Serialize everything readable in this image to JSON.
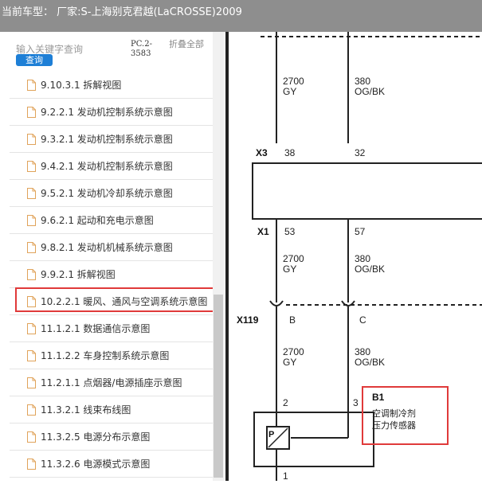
{
  "header": {
    "title": "当前车型：  厂家:S-上海别克君越(LaCROSSE)2009"
  },
  "search": {
    "placeholder": "输入关键字查询",
    "button_label": "查询"
  },
  "code_label": "PC.2-3583",
  "collapse_label": "折叠全部",
  "doc_list": {
    "items": [
      {
        "label": "9.10.3.1 拆解视图"
      },
      {
        "label": "9.2.2.1 发动机控制系统示意图"
      },
      {
        "label": "9.3.2.1 发动机控制系统示意图"
      },
      {
        "label": "9.4.2.1 发动机控制系统示意图"
      },
      {
        "label": "9.5.2.1 发动机冷却系统示意图"
      },
      {
        "label": "9.6.2.1 起动和充电示意图"
      },
      {
        "label": "9.8.2.1 发动机机械系统示意图"
      },
      {
        "label": "9.9.2.1 拆解视图"
      },
      {
        "label": "10.2.2.1 暖风、通风与空调系统示意图",
        "selected": true
      },
      {
        "label": "11.1.2.1 数据通信示意图"
      },
      {
        "label": "11.1.2.2 车身控制系统示意图"
      },
      {
        "label": "11.2.1.1 点烟器/电源插座示意图"
      },
      {
        "label": "11.3.2.1 线束布线图"
      },
      {
        "label": "11.3.2.5 电源分布示意图"
      },
      {
        "label": "11.3.2.6 电源模式示意图"
      }
    ]
  },
  "diagram": {
    "connectors": {
      "x3": "X3",
      "x1": "X1",
      "x119": "X119"
    },
    "wire_top_left": {
      "num": "2700",
      "color": "GY"
    },
    "wire_top_right": {
      "num": "380",
      "color": "OG/BK"
    },
    "x3_pins": {
      "left": "38",
      "right": "32"
    },
    "x1_pins": {
      "left": "53",
      "right": "57"
    },
    "wire_mid_left": {
      "num": "2700",
      "color": "GY"
    },
    "wire_mid_right": {
      "num": "380",
      "color": "OG/BK"
    },
    "x119_pins": {
      "left": "B",
      "right": "C"
    },
    "wire_bot_left": {
      "num": "2700",
      "color": "GY"
    },
    "wire_bot_right": {
      "num": "380",
      "color": "OG/BK"
    },
    "sensor_pins": {
      "left": "2",
      "right": "3",
      "bottom": "1"
    },
    "sensor_id": "B1",
    "sensor_name_line1": "空调制冷剂",
    "sensor_name_line2": "压力传感器",
    "sensor_symbol": "P"
  },
  "colors": {
    "titlebar": "#8e8e8e",
    "accent": "#1e7fd6",
    "highlight": "#e03a3a"
  }
}
